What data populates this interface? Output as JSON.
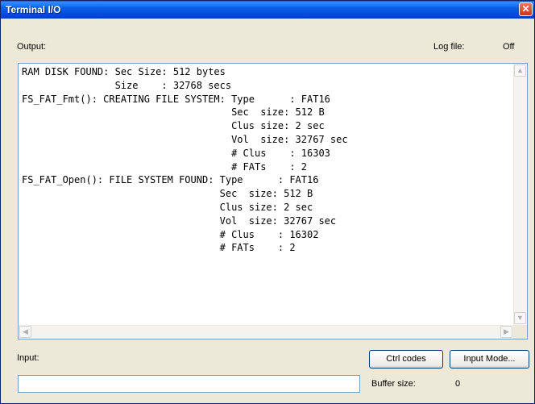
{
  "window": {
    "title": "Terminal I/O",
    "close_glyph": "✕"
  },
  "output": {
    "label": "Output:",
    "log_file_label": "Log file:",
    "log_file_value": "Off",
    "text": "RAM DISK FOUND: Sec Size: 512 bytes\n                Size    : 32768 secs\nFS_FAT_Fmt(): CREATING FILE SYSTEM: Type      : FAT16\n                                    Sec  size: 512 B\n                                    Clus size: 2 sec\n                                    Vol  size: 32767 sec\n                                    # Clus    : 16303\n                                    # FATs    : 2\nFS_FAT_Open(): FILE SYSTEM FOUND: Type      : FAT16\n                                  Sec  size: 512 B\n                                  Clus size: 2 sec\n                                  Vol  size: 32767 sec\n                                  # Clus    : 16302\n                                  # FATs    : 2"
  },
  "scrollbar": {
    "up_glyph": "▲",
    "down_glyph": "▼",
    "left_glyph": "◀",
    "right_glyph": "▶"
  },
  "input": {
    "label": "Input:",
    "value": "",
    "ctrl_codes_button": "Ctrl codes",
    "input_mode_button": "Input Mode...",
    "buffer_size_label": "Buffer size:",
    "buffer_size_value": "0"
  },
  "colors": {
    "title_bar": "#0058EE",
    "window_bg": "#ECE9D8",
    "field_border": "#7F9DB9"
  },
  "icons": [
    "close-icon",
    "scroll-up-icon",
    "scroll-down-icon",
    "scroll-left-icon",
    "scroll-right-icon"
  ]
}
